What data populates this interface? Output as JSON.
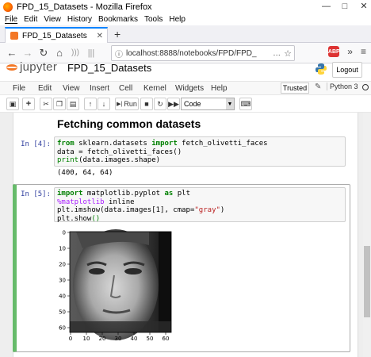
{
  "window": {
    "title": "FPD_15_Datasets - Mozilla Firefox",
    "minimize": "—",
    "maximize": "□",
    "close": "✕"
  },
  "menubar": [
    "File",
    "Edit",
    "View",
    "History",
    "Bookmarks",
    "Tools",
    "Help"
  ],
  "tab": {
    "title": "FPD_15_Datasets",
    "close": "✕",
    "new": "+"
  },
  "nav": {
    "back": "←",
    "forward": "→",
    "reload": "↻",
    "home": "⌂",
    "info": "ⓘ",
    "url": "localhost:8888/notebooks/FPD/FPD_",
    "more": "…",
    "star": "☆",
    "overflow": "»",
    "hamburger": "≡",
    "ext_badge": "ABP"
  },
  "jupyter": {
    "logo_text": "jupyter",
    "notebook_name": "FPD_15_Datasets",
    "logout": "Logout",
    "menu": [
      "File",
      "Edit",
      "View",
      "Insert",
      "Cell",
      "Kernel",
      "Widgets",
      "Help"
    ],
    "trusted": "Trusted",
    "kernel": "Python 3",
    "run_label": "Run",
    "cell_type": "Code"
  },
  "toolbar_icons": [
    "save-icon",
    "plus-icon",
    "cut-icon",
    "copy-icon",
    "paste-icon",
    "arrow-up-icon",
    "arrow-down-icon",
    "run-icon",
    "stop-icon",
    "restart-icon",
    "fast-forward-icon",
    "keyboard-icon"
  ],
  "notebook": {
    "heading": "Fetching common datasets",
    "cells": [
      {
        "prompt": "In [4]:",
        "lines": [
          [
            [
              "kw",
              "from"
            ],
            [
              "",
              " sklearn.datasets "
            ],
            [
              "kw",
              "import"
            ],
            [
              "",
              " fetch_olivetti_faces"
            ]
          ],
          [
            [
              "",
              "data = fetch_olivetti_faces()"
            ]
          ],
          [
            [
              "fn",
              "print"
            ],
            [
              "",
              "(data.images.shape)"
            ]
          ]
        ],
        "output": "(400, 64, 64)"
      },
      {
        "prompt": "In [5]:",
        "lines": [
          [
            [
              "kw",
              "import"
            ],
            [
              "",
              " matplotlib.pyplot "
            ],
            [
              "kw",
              "as"
            ],
            [
              "",
              " plt"
            ]
          ],
          [
            [
              "mag",
              "%matplotlib"
            ],
            [
              "",
              " inline"
            ]
          ],
          [
            [
              "",
              "plt.imshow(data.images[1], cmap="
            ],
            [
              "str",
              "\"gray\""
            ],
            [
              "",
              ")"
            ]
          ],
          [
            [
              "",
              "plt.show"
            ],
            [
              "fn",
              "()"
            ]
          ]
        ]
      }
    ]
  },
  "plot": {
    "xticks": [
      "0",
      "10",
      "20",
      "30",
      "40",
      "50",
      "60"
    ],
    "yticks": [
      "0",
      "10",
      "20",
      "30",
      "40",
      "50",
      "60"
    ]
  }
}
